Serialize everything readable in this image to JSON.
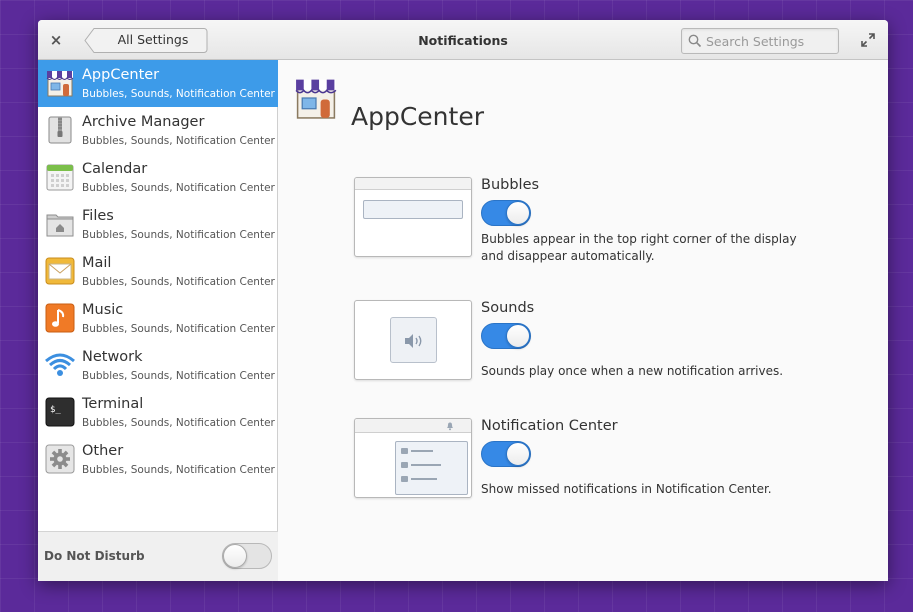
{
  "header": {
    "close_label": "×",
    "back_label": "All Settings",
    "title": "Notifications",
    "search_placeholder": "Search Settings"
  },
  "sidebar": {
    "items": [
      {
        "name": "AppCenter",
        "sub": "Bubbles, Sounds, Notification Center",
        "icon": "appcenter-icon",
        "selected": true
      },
      {
        "name": "Archive Manager",
        "sub": "Bubbles, Sounds, Notification Center",
        "icon": "archive-manager-icon"
      },
      {
        "name": "Calendar",
        "sub": "Bubbles, Sounds, Notification Center",
        "icon": "calendar-icon"
      },
      {
        "name": "Files",
        "sub": "Bubbles, Sounds, Notification Center",
        "icon": "files-icon"
      },
      {
        "name": "Mail",
        "sub": "Bubbles, Sounds, Notification Center",
        "icon": "mail-icon"
      },
      {
        "name": "Music",
        "sub": "Bubbles, Sounds, Notification Center",
        "icon": "music-icon"
      },
      {
        "name": "Network",
        "sub": "Bubbles, Sounds, Notification Center",
        "icon": "network-icon"
      },
      {
        "name": "Terminal",
        "sub": "Bubbles, Sounds, Notification Center",
        "icon": "terminal-icon"
      },
      {
        "name": "Other",
        "sub": "Bubbles, Sounds, Notification Center",
        "icon": "gear-icon"
      }
    ],
    "dnd": {
      "label": "Do Not Disturb",
      "enabled": false
    }
  },
  "content": {
    "title": "AppCenter",
    "settings": [
      {
        "title": "Bubbles",
        "enabled": true,
        "description": "Bubbles appear in the top right corner of the display and disappear automatically."
      },
      {
        "title": "Sounds",
        "enabled": true,
        "description": "Sounds play once when a new notification arrives."
      },
      {
        "title": "Notification Center",
        "enabled": true,
        "description": "Show missed notifications in Notification Center."
      }
    ]
  },
  "colors": {
    "accent": "#3689e6",
    "selection": "#3d9be9",
    "desktop": "#5b2a9a"
  }
}
